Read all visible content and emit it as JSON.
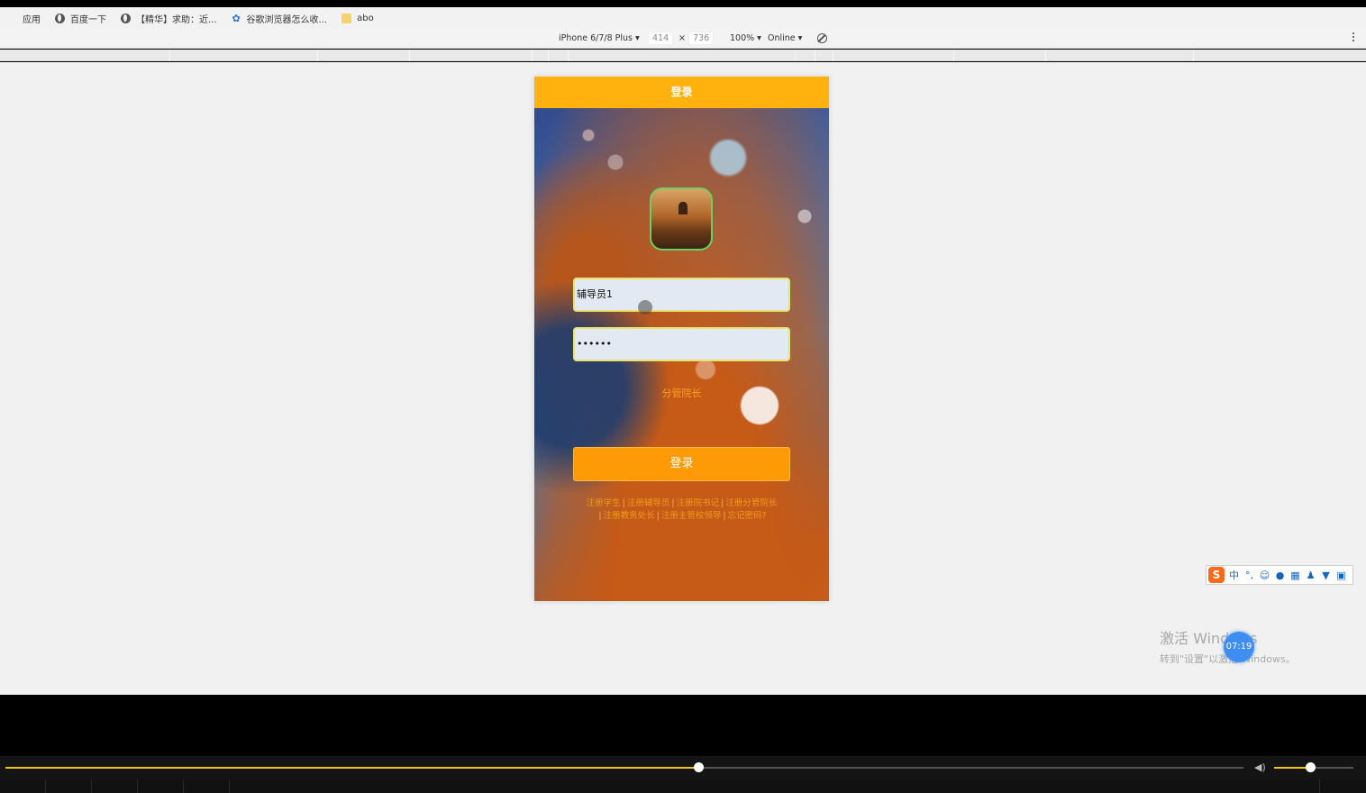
{
  "bookmarks": [
    {
      "label": "应用",
      "icon": "apps-icon"
    },
    {
      "label": "百度一下",
      "icon": "globe-icon"
    },
    {
      "label": "【精华】求助：近...",
      "icon": "globe-icon"
    },
    {
      "label": "谷歌浏览器怎么收...",
      "icon": "paw-icon"
    },
    {
      "label": "abo",
      "icon": "folder-icon"
    }
  ],
  "device_toolbar": {
    "device": "iPhone 6/7/8 Plus ▾",
    "width": "414",
    "times": "×",
    "height": "736",
    "zoom": "100% ▾",
    "network": "Online ▾"
  },
  "phone": {
    "header_title": "登录",
    "username_value": "辅导员1",
    "password_value": "••••••",
    "role_label": "分管院长",
    "login_button": "登录",
    "links": [
      "注册学生",
      "注册辅导员",
      "注册院书记",
      "注册分管院长",
      "注册教务处长",
      "注册主管校领导",
      "忘记密码?"
    ],
    "separator": "|"
  },
  "ime": {
    "logo": "S",
    "mode": "中",
    "punct": "°,"
  },
  "watermark": {
    "line1": "激活 Windows",
    "line2": "转到\"设置\"以激活 Windows。"
  },
  "player": {
    "time": "07:19",
    "progress": 0.56,
    "volume": 0.45
  },
  "colors": {
    "header": "#ffb20e",
    "button": "#ff9a07",
    "link": "#ef9a22",
    "progress": "#f5c400"
  }
}
